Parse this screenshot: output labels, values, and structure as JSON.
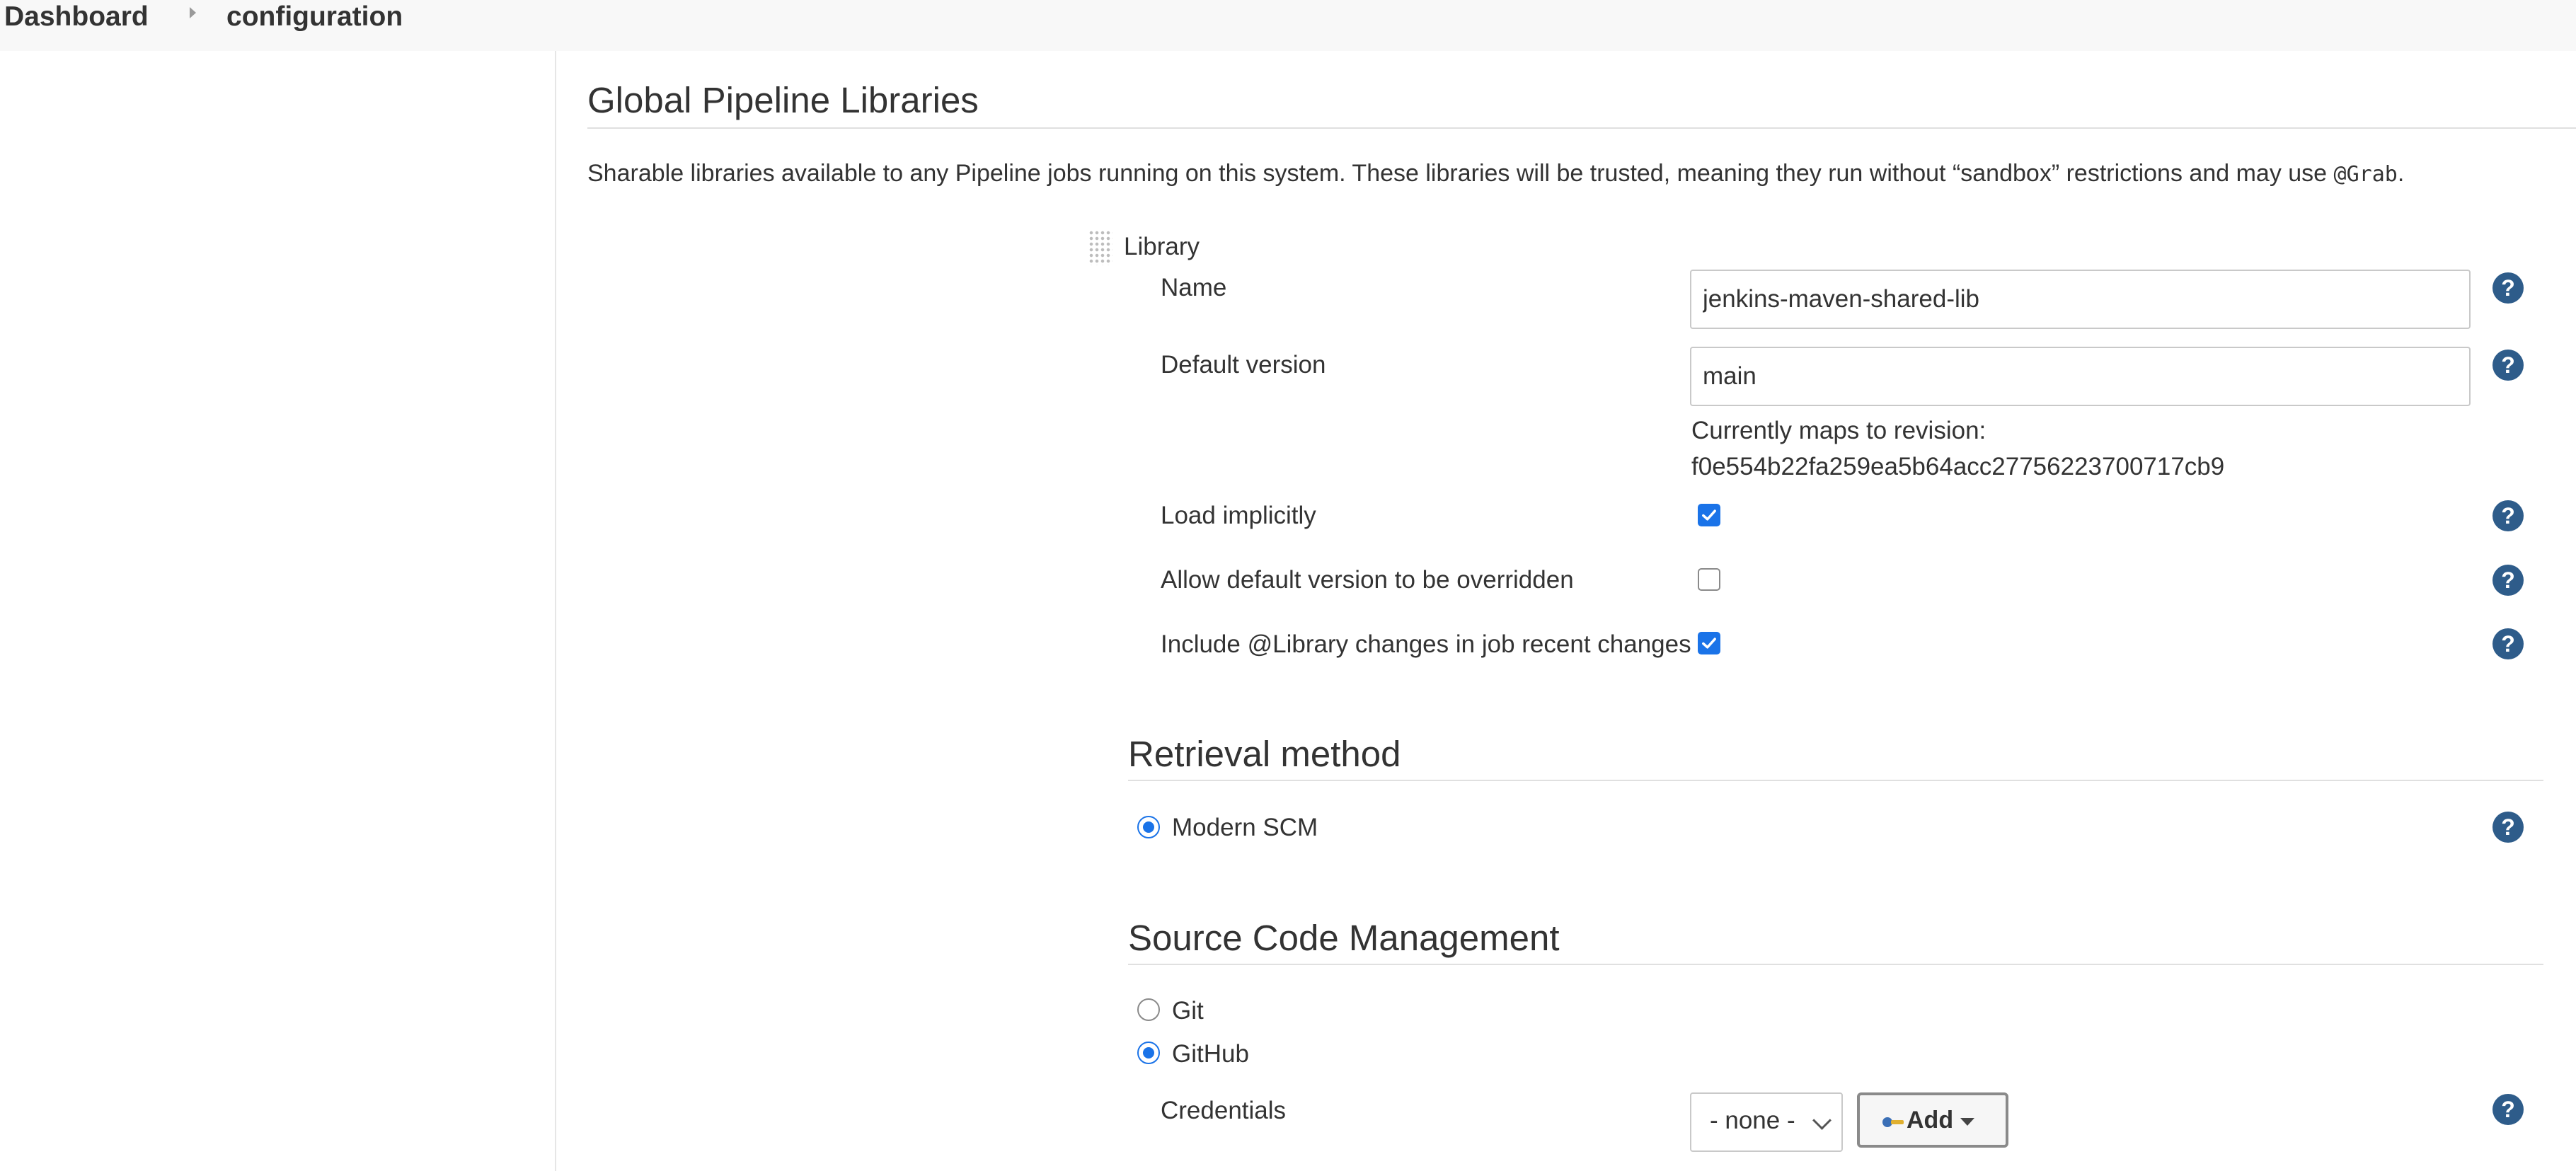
{
  "breadcrumb": {
    "items": [
      "Dashboard",
      "configuration"
    ]
  },
  "section": {
    "title": "Global Pipeline Libraries",
    "description_pre": "Sharable libraries available to any Pipeline jobs running on this system. These libraries will be trusted, meaning they run without “sandbox” restrictions and may use ",
    "description_code": "@Grab",
    "description_post": "."
  },
  "library": {
    "header": "Library",
    "name": {
      "label": "Name",
      "value": "jenkins-maven-shared-lib"
    },
    "default_version": {
      "label": "Default version",
      "value": "main",
      "revision_label": "Currently maps to revision:",
      "revision_hash": "f0e554b22fa259ea5b64acc27756223700717cb9"
    },
    "load_implicitly": {
      "label": "Load implicitly",
      "checked": true
    },
    "allow_override": {
      "label": "Allow default version to be overridden",
      "checked": false
    },
    "include_changes": {
      "label": "Include @Library changes in job recent changes",
      "checked": true
    }
  },
  "retrieval": {
    "title": "Retrieval method",
    "options": [
      {
        "label": "Modern SCM",
        "selected": true
      }
    ]
  },
  "scm": {
    "title": "Source Code Management",
    "options": [
      {
        "label": "Git",
        "selected": false
      },
      {
        "label": "GitHub",
        "selected": true
      }
    ],
    "credentials": {
      "label": "Credentials",
      "selected": "- none -",
      "add_label": "Add"
    }
  },
  "help_icon_glyph": "?",
  "colors": {
    "accent": "#1a73e8",
    "help": "#2e5c8a"
  }
}
